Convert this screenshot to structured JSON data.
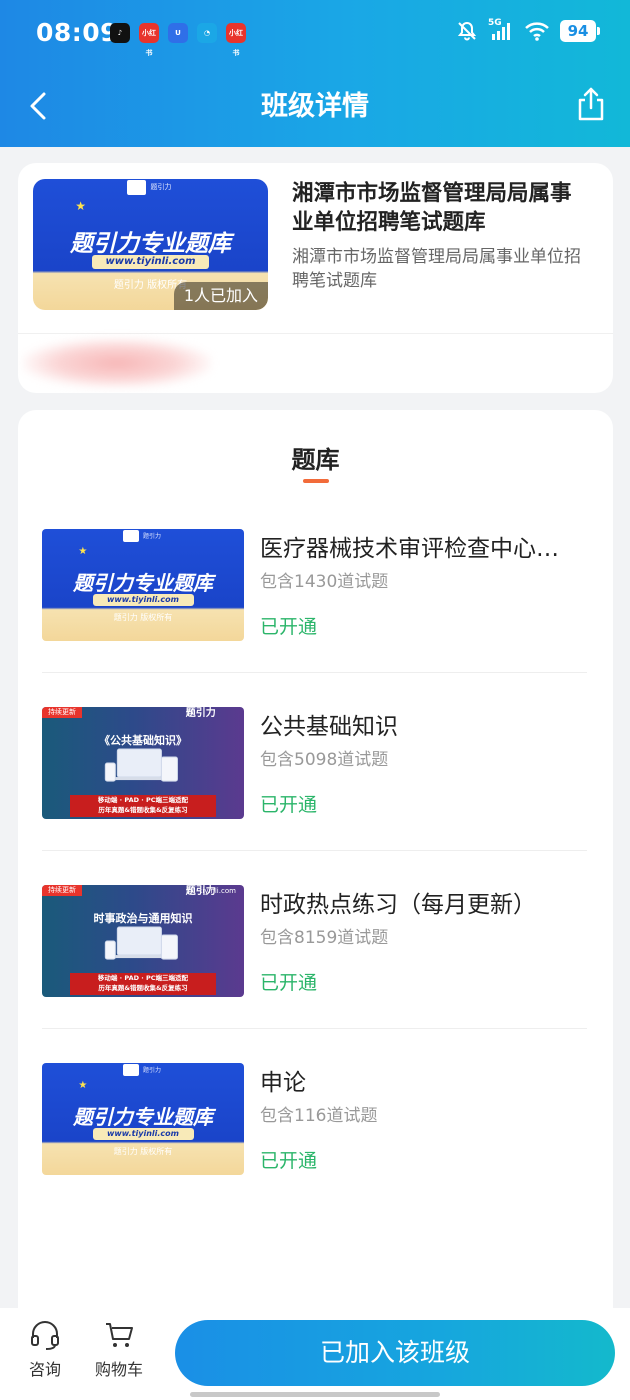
{
  "status_bar": {
    "time": "08:09",
    "battery": "94",
    "network": "5G",
    "app_icons": [
      {
        "name": "tiktok-icon",
        "color": "#111111",
        "text": "♪"
      },
      {
        "name": "xiaohongshu-icon",
        "color": "#e8342c",
        "text": "小红书"
      },
      {
        "name": "shield-app-icon",
        "color": "#2f6fe8",
        "text": "U"
      },
      {
        "name": "chat-app-icon",
        "color": "#1ba7e6",
        "text": "◔"
      },
      {
        "name": "xiaohongshu-icon-2",
        "color": "#e8342c",
        "text": "小红书"
      }
    ]
  },
  "nav": {
    "title": "班级详情"
  },
  "class_info": {
    "title": "湘潭市市场监督管理局局属事业单位招聘笔试题库",
    "subtitle": "湘潭市市场监督管理局局属事业单位招聘笔试题库",
    "joined": "1人已加入",
    "thumb": {
      "brand": "题引力专业题库",
      "url": "www.tiyinli.com",
      "copyright": "题引力 版权所有",
      "logo_text": "题引力"
    }
  },
  "bank": {
    "heading": "题库",
    "items": [
      {
        "name": "医疗器械技术审评检查中心…",
        "count": "包含1430道试题",
        "status": "已开通",
        "thumb_type": "blue",
        "thumb": {
          "brand": "题引力专业题库",
          "url": "www.tiyinli.com",
          "copyright": "题引力 版权所有",
          "logo_text": "题引力"
        }
      },
      {
        "name": "公共基础知识",
        "count": "包含5098道试题",
        "status": "已开通",
        "thumb_type": "purple",
        "thumb": {
          "tag": "持续更新",
          "headline": "《公共基础知识》",
          "bar_line1": "移动端 · PAD · PC端三端适配",
          "bar_line2": "历年真题&错题收集&反复练习",
          "logo": "题引力",
          "site": ""
        }
      },
      {
        "name": "时政热点练习（每月更新）",
        "count": "包含8159道试题",
        "status": "已开通",
        "thumb_type": "purple",
        "thumb": {
          "tag": "持续更新",
          "headline": "时事政治与通用知识",
          "bar_line1": "移动端 · PAD · PC端三端适配",
          "bar_line2": "历年真题&错题收集&反复练习",
          "logo": "题引力",
          "site": "tiyinli.com"
        }
      },
      {
        "name": "申论",
        "count": "包含116道试题",
        "status": "已开通",
        "thumb_type": "blue",
        "thumb": {
          "brand": "题引力专业题库",
          "url": "www.tiyinli.com",
          "copyright": "题引力 版权所有",
          "logo_text": "题引力"
        }
      }
    ]
  },
  "bottom_bar": {
    "consult_label": "咨询",
    "cart_label": "购物车",
    "join_button": "已加入该班级"
  },
  "colors": {
    "header_start": "#1e88e5",
    "header_end": "#12b8d8",
    "status_green": "#2bb56a",
    "accent_orange": "#f26b3a"
  }
}
